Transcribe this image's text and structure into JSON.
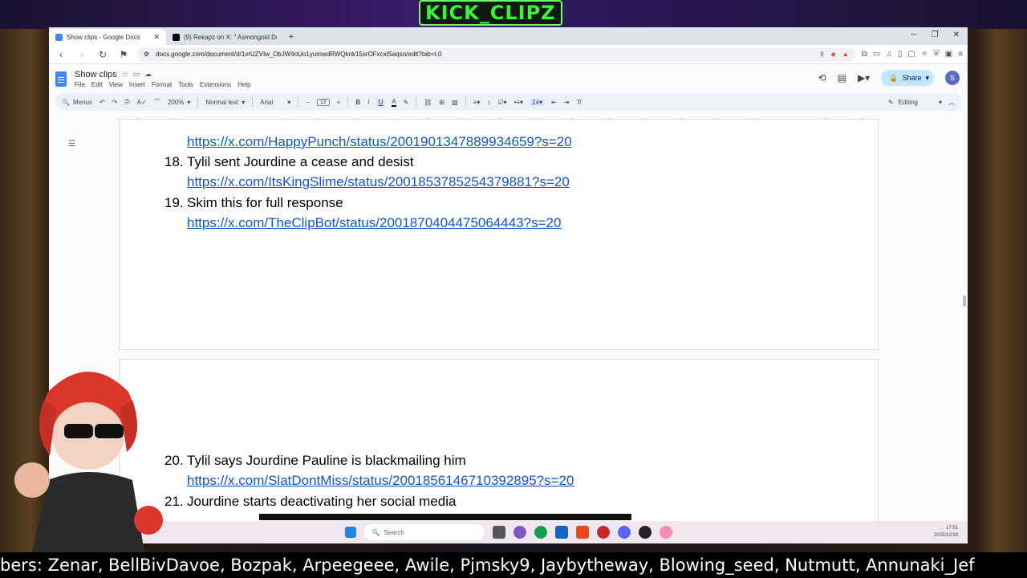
{
  "overlay": {
    "brand": "KICK_CLIPZ",
    "ticker": "bers: Zenar, BellBivDavoe, Bozpak, Arpeegeee, Awile, Pjmsky9, Jaybytheway, Blowing_seed, Nutmutt, Annunaki_Jef"
  },
  "browser": {
    "tabs": [
      {
        "title": "Show clips - Google Docs",
        "active": true
      },
      {
        "title": "(9) Rekapz on X: \" Asmongold Del",
        "active": false
      }
    ],
    "url": "docs.google.com/document/d/1vrUZVIw_DbJW4oUo1yumwdRWQknk15srOFxcxlSaqso/edit?tab=t.0"
  },
  "docs": {
    "title": "Show clips",
    "menus": [
      "File",
      "Edit",
      "View",
      "Insert",
      "Format",
      "Tools",
      "Extensions",
      "Help"
    ],
    "share": "Share",
    "avatar": "S",
    "toolbar": {
      "menus": "Menus",
      "zoom": "200%",
      "style": "Normal text",
      "font": "Arial",
      "font_size": "12",
      "mode": "Editing"
    },
    "ruler": [
      "2",
      "1",
      "1",
      "2",
      "3",
      "4",
      "5",
      "6",
      "7",
      "8",
      "9",
      "10",
      "11",
      "12",
      "13",
      "14",
      "15",
      "16",
      "17",
      "18"
    ],
    "items": [
      {
        "link": "https://x.com/HappyPunch/status/2001901347889934659?s=20"
      },
      {
        "num": "18.",
        "text": "Tylil sent Jourdine a cease and desist",
        "link": "https://x.com/ItsKingSlime/status/2001853785254379881?s=20"
      },
      {
        "num": "19.",
        "text": "Skim this for full response",
        "link": "https://x.com/TheClipBot/status/2001870404475064443?s=20"
      },
      {
        "num": "20.",
        "text": "Tylil says Jourdine Pauline is blackmailing him",
        "link": "https://x.com/SlatDontMiss/status/2001856146710392895?s=20"
      },
      {
        "num": "21.",
        "text": "Jourdine starts deactivating her social media"
      }
    ]
  },
  "taskbar": {
    "search": "Search",
    "time": "17:51",
    "date": "2025/12/19"
  }
}
